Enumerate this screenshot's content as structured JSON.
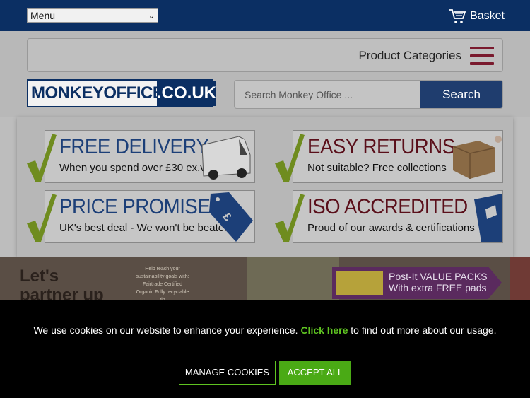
{
  "topbar": {
    "menu_label": "Menu",
    "basket_label": "Basket"
  },
  "header": {
    "categories_label": "Product Categories",
    "logo_left": "MONKEYOFFICE",
    "logo_right": ".CO.UK",
    "search_placeholder": "Search Monkey Office ...",
    "search_button": "Search"
  },
  "promos": [
    {
      "title": "FREE DELIVERY",
      "subtitle": "When you spend over £30 ex.vat"
    },
    {
      "title": "EASY RETURNS",
      "subtitle": "Not suitable? Free collections"
    },
    {
      "title": "PRICE PROMISE",
      "subtitle": "UK's best deal - We won't be beaten"
    },
    {
      "title": "ISO ACCREDITED",
      "subtitle": "Proud of our awards & certifications"
    }
  ],
  "banner": {
    "headline_1": "Let's",
    "headline_2": "partner up",
    "small_text": "Help reach your sustainability goals with: Fairtrade Certified Organic Fully recyclable tin",
    "postit_line_1": "Post-It VALUE PACKS",
    "postit_line_2": "With extra FREE pads"
  },
  "cookie": {
    "message_before": "We use cookies on our website to enhance your experience. ",
    "link_text": "Click here",
    "message_after": " to find out more about our usage.",
    "manage_label": "MANAGE COOKIES",
    "accept_label": "ACCEPT ALL"
  },
  "colors": {
    "navy": "#0b2f63",
    "accent_green": "#4aaa15",
    "maroon": "#7a1a2e"
  }
}
